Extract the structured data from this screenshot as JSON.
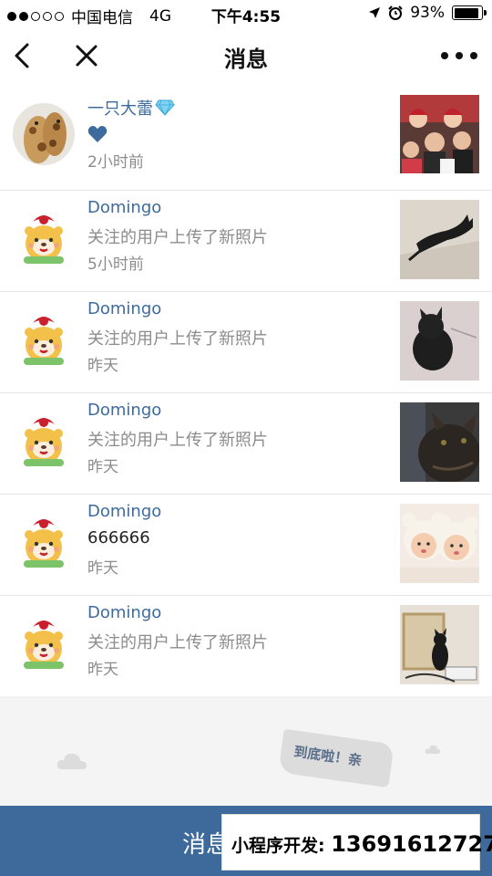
{
  "status_bar": {
    "carrier": "中国电信",
    "network": "4G",
    "time": "下午4:55",
    "battery_text": "93%",
    "battery_level": 0.93,
    "signal_dots_filled": 2,
    "signal_dots_total": 5
  },
  "nav": {
    "title": "消息",
    "back_icon": "chevron-left-icon",
    "close_icon": "close-icon",
    "more_icon": "more-dots-icon"
  },
  "messages": [
    {
      "name": "一只大蕾",
      "text": "",
      "time": "2小时前",
      "avatar": "giraffe-avatar",
      "thumb": "family-photo",
      "has_heart": true,
      "name_emoji": "gem-icon"
    },
    {
      "name": "Domingo",
      "text": "关注的用户上传了新照片",
      "time": "5小时前",
      "avatar": "cartoon-bear-avatar",
      "thumb": "cat-photo-1"
    },
    {
      "name": "Domingo",
      "text": "关注的用户上传了新照片",
      "time": "昨天",
      "avatar": "cartoon-bear-avatar",
      "thumb": "cat-photo-2"
    },
    {
      "name": "Domingo",
      "text": "关注的用户上传了新照片",
      "time": "昨天",
      "avatar": "cartoon-bear-avatar",
      "thumb": "cat-photo-3"
    },
    {
      "name": "Domingo",
      "text": "666666",
      "time": "昨天",
      "avatar": "cartoon-bear-avatar",
      "thumb": "babies-photo"
    },
    {
      "name": "Domingo",
      "text": "关注的用户上传了新照片",
      "time": "昨天",
      "avatar": "cartoon-bear-avatar",
      "thumb": "cat-photo-4"
    }
  ],
  "footer": {
    "end_text": "到底啦！亲"
  },
  "bottom_bar": {
    "label": "消息"
  },
  "promo": {
    "label": "小程序开发:",
    "phone": "13691612727"
  },
  "colors": {
    "link_blue": "#3d6b9e",
    "bottom_bar": "#3d6a9a",
    "gray_text": "#8c8c8c"
  }
}
